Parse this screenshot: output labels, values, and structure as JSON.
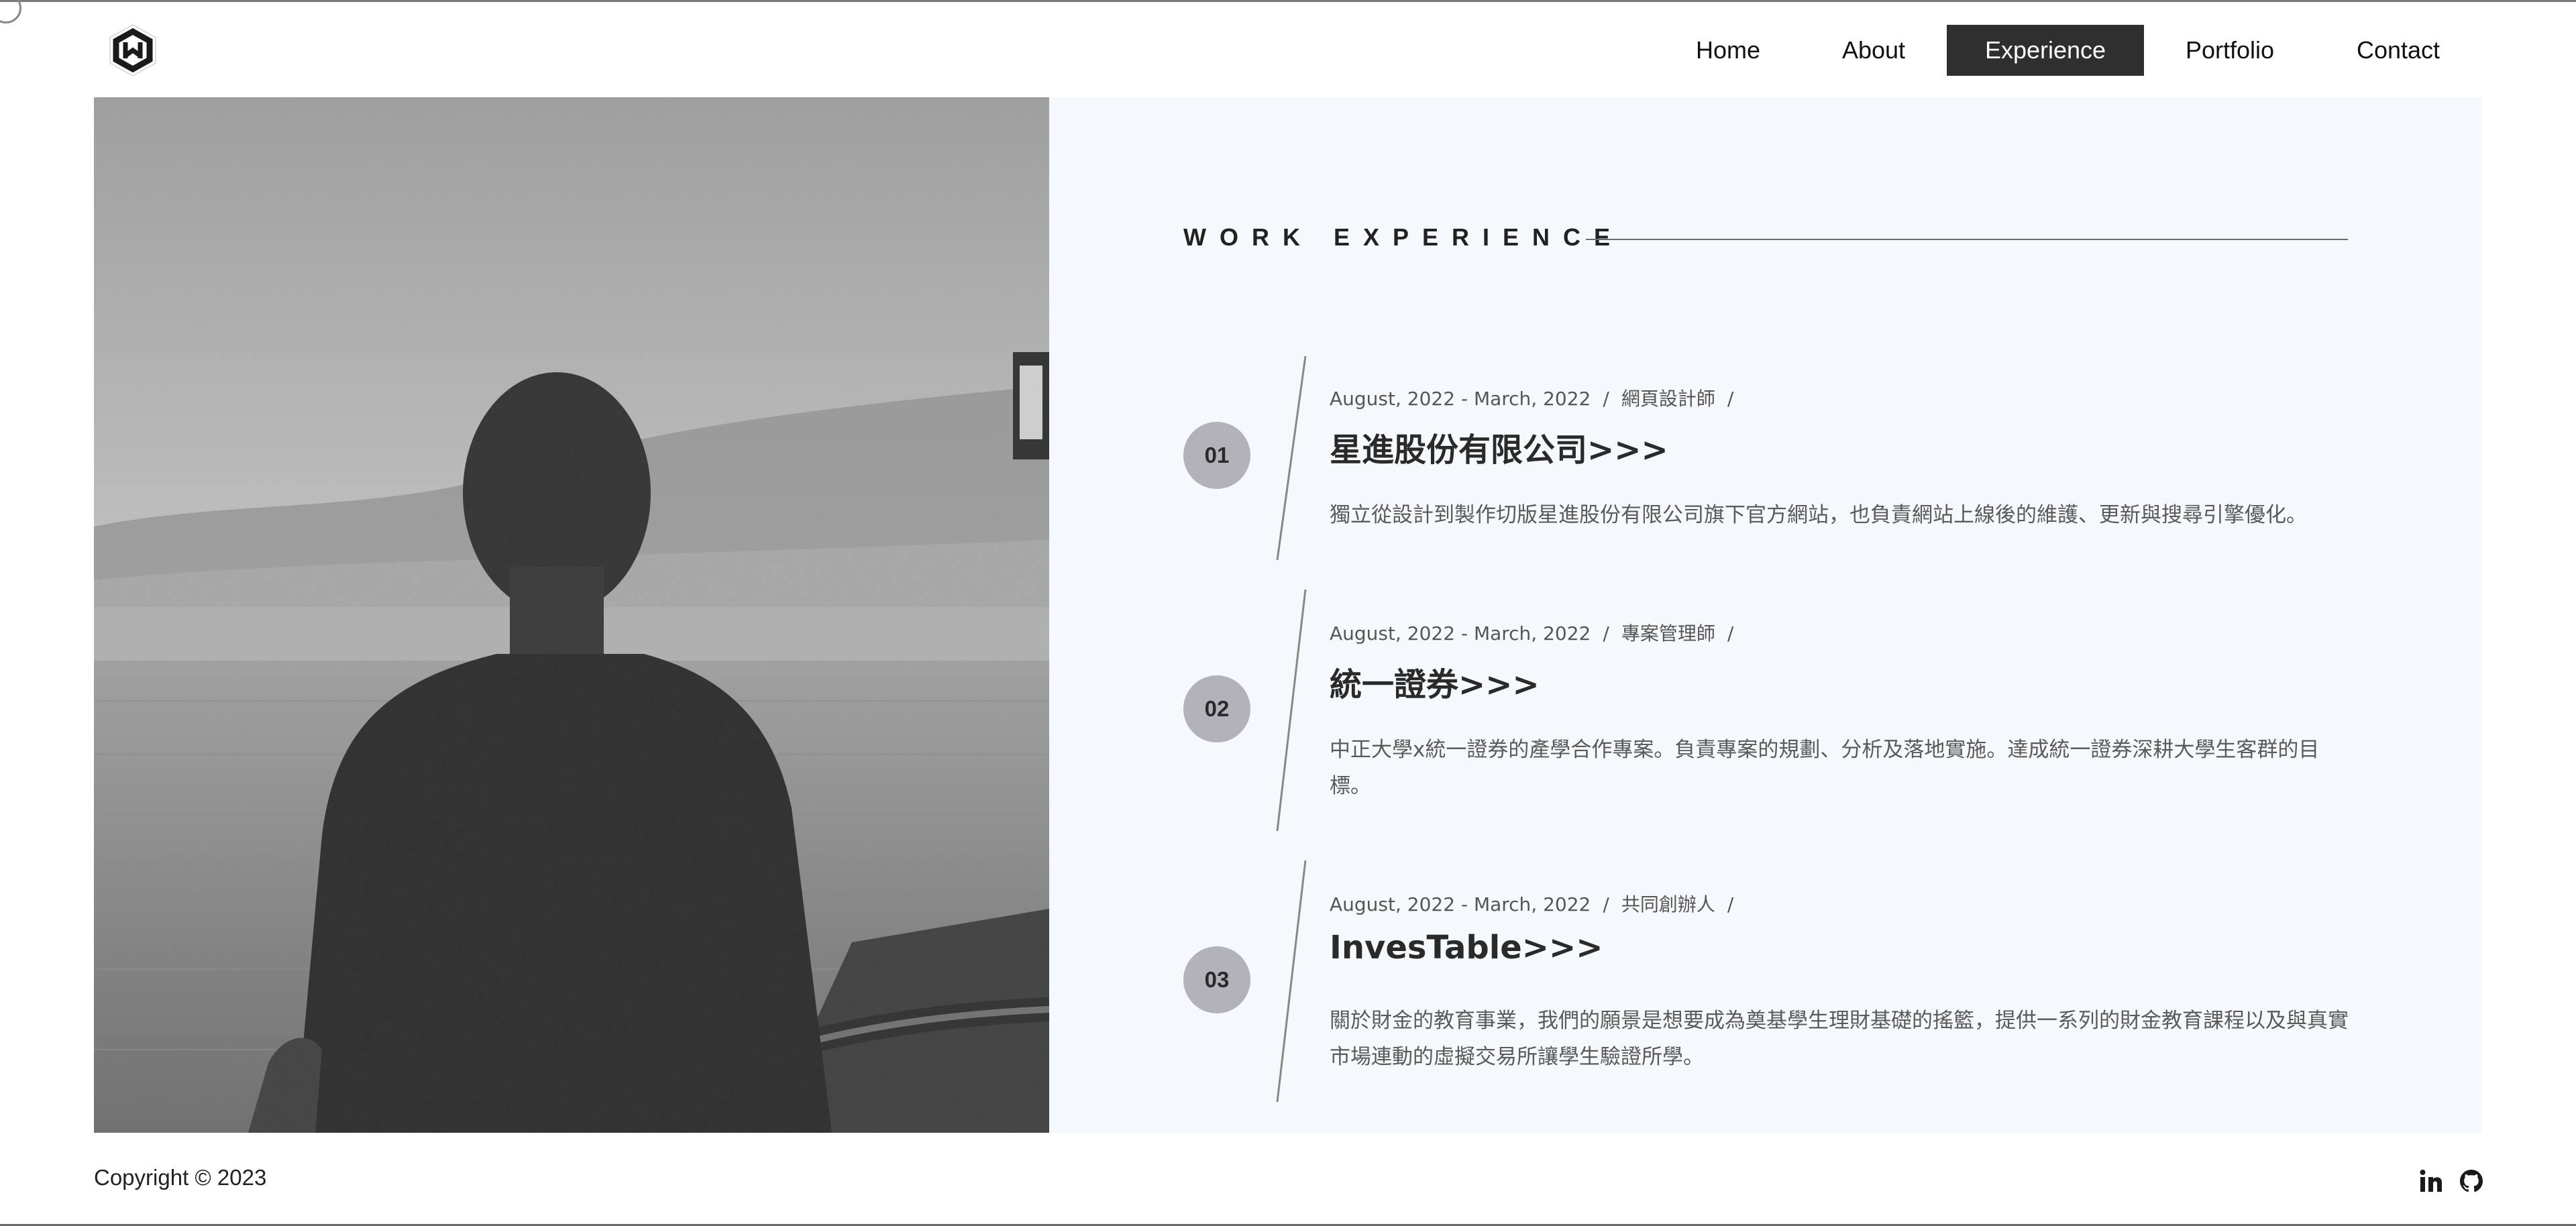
{
  "nav": {
    "items": [
      {
        "label": "Home",
        "active": false
      },
      {
        "label": "About",
        "active": false
      },
      {
        "label": "Experience",
        "active": true
      },
      {
        "label": "Portfolio",
        "active": false
      },
      {
        "label": "Contact",
        "active": false
      }
    ]
  },
  "section": {
    "title": "WORK EXPERIENCE"
  },
  "experiences": [
    {
      "number": "01",
      "dates": "August, 2022 - March, 2022",
      "role": "網頁設計師",
      "company": "星進股份有限公司>>>",
      "description": "獨立從設計到製作切版星進股份有限公司旗下官方網站，也負責網站上線後的維護、更新與搜尋引擎優化。"
    },
    {
      "number": "02",
      "dates": "August, 2022 - March, 2022",
      "role": "專案管理師",
      "company": "統一證券>>>",
      "description": "中正大學x統一證券的產學合作專案。負責專案的規劃、分析及落地實施。達成統一證券深耕大學生客群的目標。"
    },
    {
      "number": "03",
      "dates": "August, 2022 - March, 2022",
      "role": "共同創辦人",
      "company": "InvesTable>>>",
      "description": "關於財金的教育事業，我們的願景是想要成為奠基學生理財基礎的搖籃，提供一系列的財金教育課程以及與真實市場連動的虛擬交易所讓學生驗證所學。"
    }
  ],
  "footer": {
    "copyright": "Copyright © 2023",
    "social": [
      {
        "icon": "linkedin-icon"
      },
      {
        "icon": "github-icon"
      }
    ]
  },
  "colors": {
    "nav_active_bg": "#2f2f2f",
    "panel_bg": "#f5f9fc",
    "badge_bg": "#b3b1ba"
  }
}
